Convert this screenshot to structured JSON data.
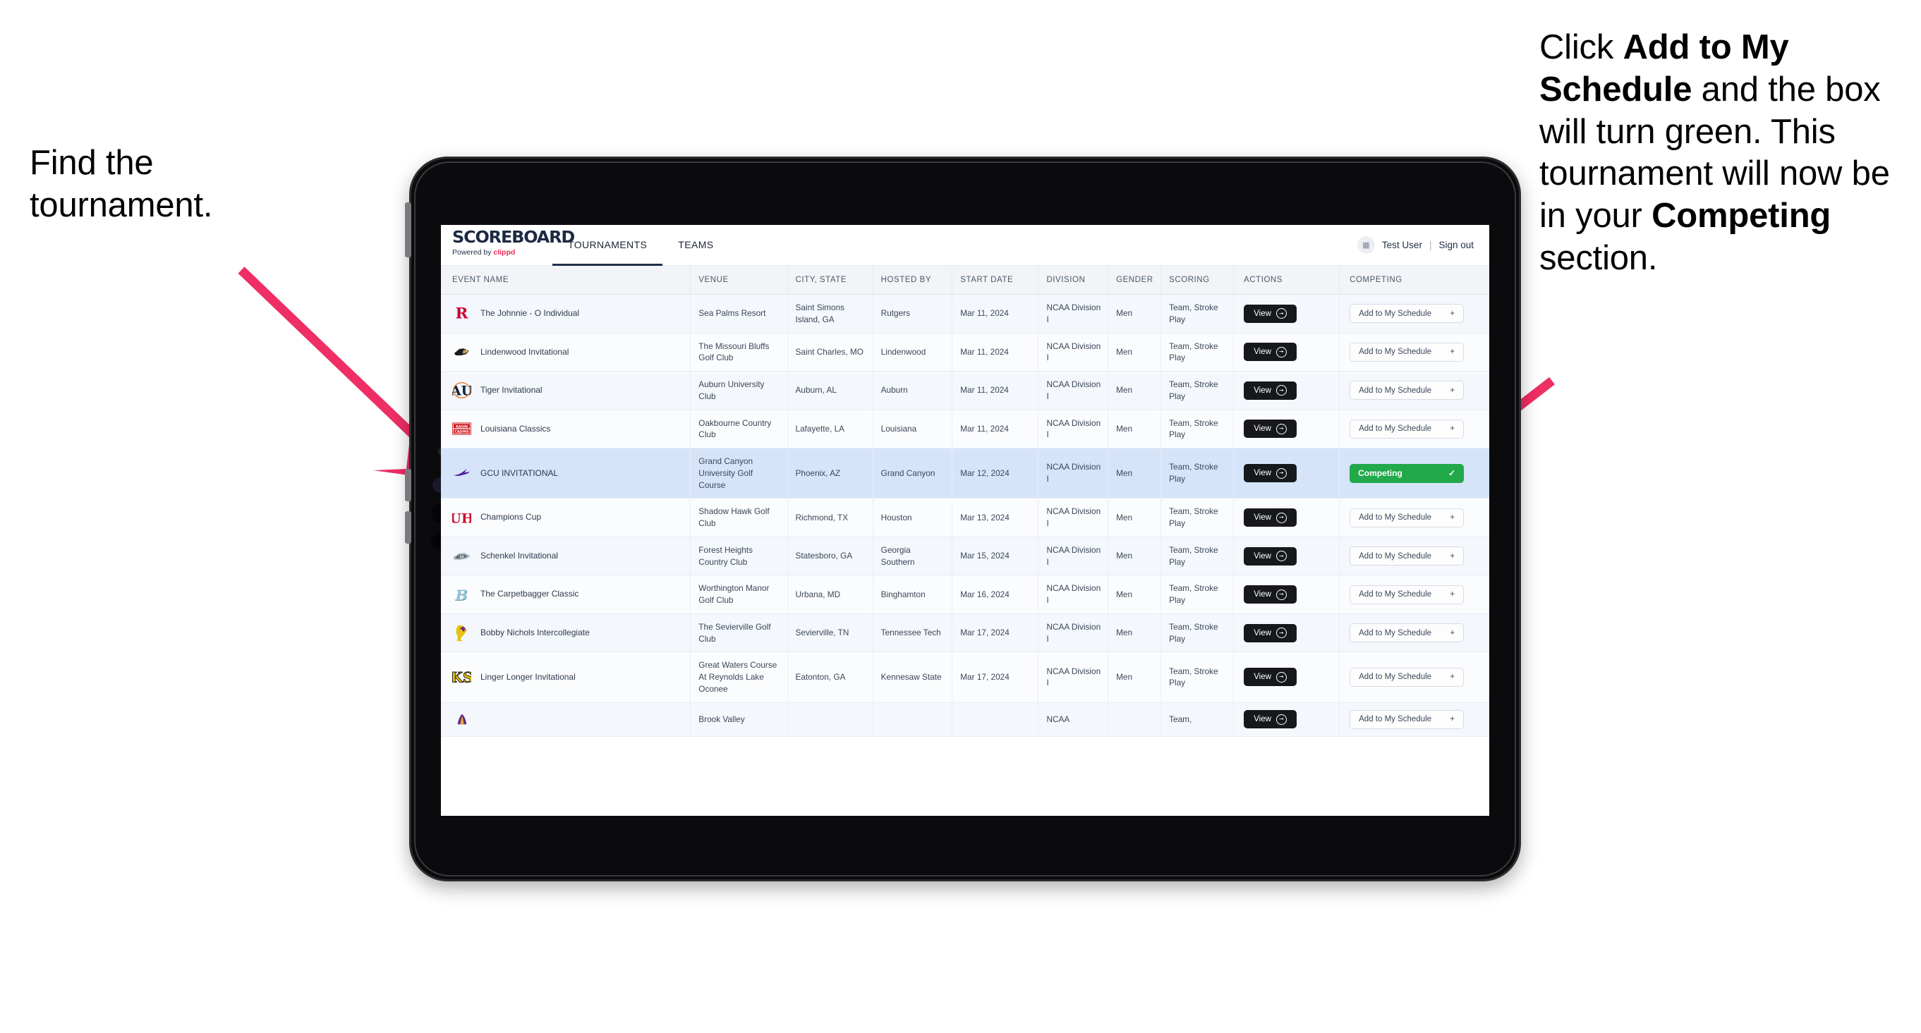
{
  "annotations": {
    "left": {
      "line1": "Find the",
      "line2": "tournament."
    },
    "right": {
      "pre": "Click ",
      "bold1": "Add to My Schedule",
      "mid": " and the box will turn green. This tournament will now be in your ",
      "bold2": "Competing",
      "post": " section."
    },
    "arrow_color": "#ef2e63"
  },
  "app": {
    "brand": {
      "title": "SCOREBOARD",
      "powered_prefix": "Powered by ",
      "powered_name": "clippd"
    },
    "nav": [
      {
        "label": "TOURNAMENTS",
        "active": true
      },
      {
        "label": "TEAMS",
        "active": false
      }
    ],
    "header_right": {
      "avatar_icon": "user-avatar-icon",
      "user": "Test User",
      "separator": "|",
      "signout": "Sign out"
    },
    "table": {
      "columns": [
        "EVENT NAME",
        "VENUE",
        "CITY, STATE",
        "HOSTED BY",
        "START DATE",
        "DIVISION",
        "GENDER",
        "SCORING",
        "ACTIONS",
        "COMPETING"
      ],
      "view_label": "View",
      "add_label": "Add to My Schedule",
      "add_icon": "plus-icon",
      "competing_label": "Competing",
      "competing_icon": "check-icon",
      "competing_color": "#22a94a",
      "rows": [
        {
          "logo": "rutgers-logo",
          "event": "The Johnnie - O Individual",
          "venue": "Sea Palms Resort",
          "city": "Saint Simons Island, GA",
          "host": "Rutgers",
          "date": "Mar 11, 2024",
          "division": "NCAA Division I",
          "gender": "Men",
          "scoring": "Team, Stroke Play",
          "competing": false
        },
        {
          "logo": "lindenwood-logo",
          "event": "Lindenwood Invitational",
          "venue": "The Missouri Bluffs Golf Club",
          "city": "Saint Charles, MO",
          "host": "Lindenwood",
          "date": "Mar 11, 2024",
          "division": "NCAA Division I",
          "gender": "Men",
          "scoring": "Team, Stroke Play",
          "competing": false
        },
        {
          "logo": "auburn-logo",
          "event": "Tiger Invitational",
          "venue": "Auburn University Club",
          "city": "Auburn, AL",
          "host": "Auburn",
          "date": "Mar 11, 2024",
          "division": "NCAA Division I",
          "gender": "Men",
          "scoring": "Team, Stroke Play",
          "competing": false
        },
        {
          "logo": "louisiana-logo",
          "event": "Louisiana Classics",
          "venue": "Oakbourne Country Club",
          "city": "Lafayette, LA",
          "host": "Louisiana",
          "date": "Mar 11, 2024",
          "division": "NCAA Division I",
          "gender": "Men",
          "scoring": "Team, Stroke Play",
          "competing": false
        },
        {
          "logo": "grand-canyon-logo",
          "event": "GCU INVITATIONAL",
          "venue": "Grand Canyon University Golf Course",
          "city": "Phoenix, AZ",
          "host": "Grand Canyon",
          "date": "Mar 12, 2024",
          "division": "NCAA Division I",
          "gender": "Men",
          "scoring": "Team, Stroke Play",
          "competing": true
        },
        {
          "logo": "houston-logo",
          "event": "Champions Cup",
          "venue": "Shadow Hawk Golf Club",
          "city": "Richmond, TX",
          "host": "Houston",
          "date": "Mar 13, 2024",
          "division": "NCAA Division I",
          "gender": "Men",
          "scoring": "Team, Stroke Play",
          "competing": false
        },
        {
          "logo": "georgia-southern-logo",
          "event": "Schenkel Invitational",
          "venue": "Forest Heights Country Club",
          "city": "Statesboro, GA",
          "host": "Georgia Southern",
          "date": "Mar 15, 2024",
          "division": "NCAA Division I",
          "gender": "Men",
          "scoring": "Team, Stroke Play",
          "competing": false
        },
        {
          "logo": "binghamton-logo",
          "event": "The Carpetbagger Classic",
          "venue": "Worthington Manor Golf Club",
          "city": "Urbana, MD",
          "host": "Binghamton",
          "date": "Mar 16, 2024",
          "division": "NCAA Division I",
          "gender": "Men",
          "scoring": "Team, Stroke Play",
          "competing": false
        },
        {
          "logo": "tennessee-tech-logo",
          "event": "Bobby Nichols Intercollegiate",
          "venue": "The Sevierville Golf Club",
          "city": "Sevierville, TN",
          "host": "Tennessee Tech",
          "date": "Mar 17, 2024",
          "division": "NCAA Division I",
          "gender": "Men",
          "scoring": "Team, Stroke Play",
          "competing": false
        },
        {
          "logo": "kennesaw-state-logo",
          "event": "Linger Longer Invitational",
          "venue": "Great Waters Course At Reynolds Lake Oconee",
          "city": "Eatonton, GA",
          "host": "Kennesaw State",
          "date": "Mar 17, 2024",
          "division": "NCAA Division I",
          "gender": "Men",
          "scoring": "Team, Stroke Play",
          "competing": false
        },
        {
          "logo": "partial-logo",
          "event": "",
          "venue": "Brook Valley",
          "city": "",
          "host": "",
          "date": "",
          "division": "NCAA",
          "gender": "",
          "scoring": "Team,",
          "competing": false
        }
      ]
    }
  }
}
